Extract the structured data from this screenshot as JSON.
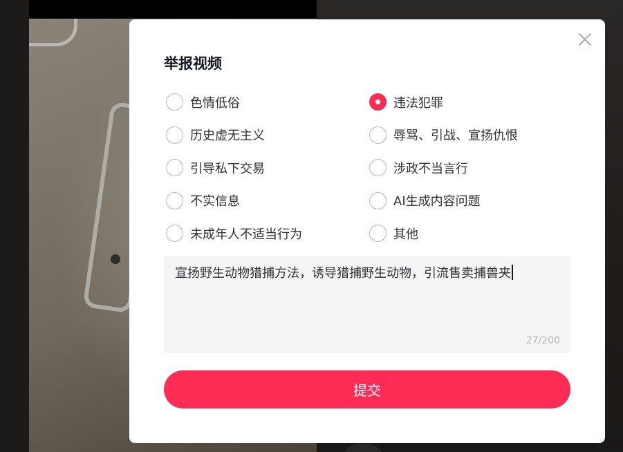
{
  "dialog": {
    "title": "举报视频",
    "close_icon": "close-icon",
    "options": [
      {
        "label": "色情低俗",
        "checked": false
      },
      {
        "label": "违法犯罪",
        "checked": true
      },
      {
        "label": "历史虚无主义",
        "checked": false
      },
      {
        "label": "辱骂、引战、宣扬仇恨",
        "checked": false
      },
      {
        "label": "引导私下交易",
        "checked": false
      },
      {
        "label": "涉政不当言行",
        "checked": false
      },
      {
        "label": "不实信息",
        "checked": false
      },
      {
        "label": "AI生成内容问题",
        "checked": false
      },
      {
        "label": "未成年人不适当行为",
        "checked": false
      },
      {
        "label": "其他",
        "checked": false
      }
    ],
    "textarea_value": "宣扬野生动物猎捕方法，诱导猎捕野生动物，引流售卖捕兽夹",
    "char_count": "27/200",
    "submit_label": "提交"
  },
  "colors": {
    "accent": "#fe2c55",
    "text": "#2f2f35",
    "muted": "#b5b5b5"
  }
}
